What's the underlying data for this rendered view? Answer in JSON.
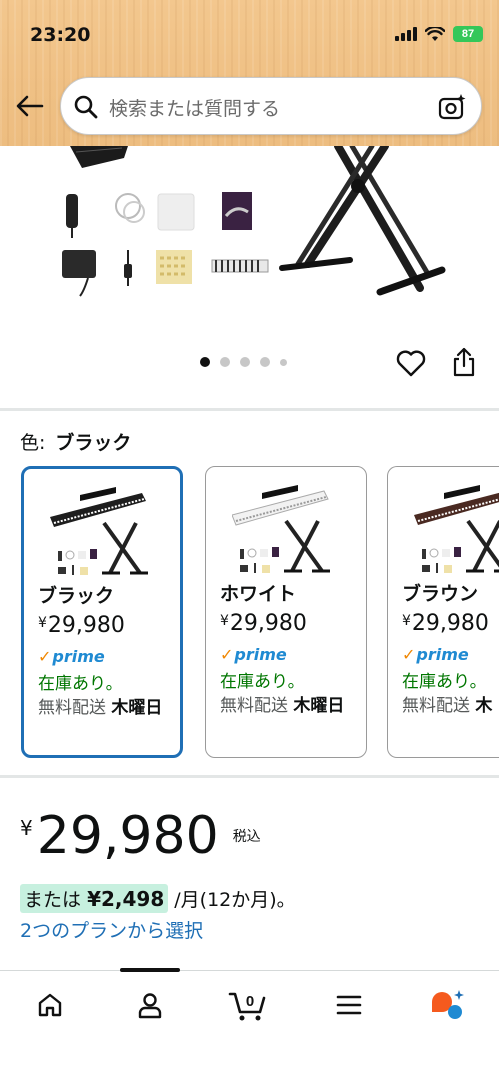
{
  "status_bar": {
    "time": "23:20",
    "battery": "87"
  },
  "search": {
    "placeholder": "検索または質問する"
  },
  "product": {
    "color_label": "色:",
    "color_value": "ブラック",
    "carousel": {
      "total": 5,
      "active_index": 0
    }
  },
  "variants": [
    {
      "name": "ブラック",
      "currency": "¥",
      "price": "29,980",
      "prime": "prime",
      "stock": "在庫あり。",
      "shipping": "無料配送",
      "day": "木曜日",
      "selected": true
    },
    {
      "name": "ホワイト",
      "currency": "¥",
      "price": "29,980",
      "prime": "prime",
      "stock": "在庫あり。",
      "shipping": "無料配送",
      "day": "木曜日",
      "selected": false
    },
    {
      "name": "ブラウン",
      "currency": "¥",
      "price": "29,980",
      "prime": "prime",
      "stock": "在庫あり。",
      "shipping": "無料配送",
      "day": "木",
      "selected": false
    }
  ],
  "price": {
    "currency": "¥",
    "amount": "29,980",
    "tax_note": "税込",
    "installment_prefix": "または",
    "installment_amount": "¥2,498",
    "installment_suffix": "/月(12か月)。",
    "plan_link": "2つのプランから選択"
  },
  "nav": {
    "cart_count": "0"
  },
  "colors": {
    "header_bg": "#efc084",
    "selected_border": "#1f6fb5",
    "in_stock": "#007600",
    "prime_blue": "#1f8ad2",
    "installment_highlight": "#c7f0df",
    "battery": "#34c759"
  }
}
